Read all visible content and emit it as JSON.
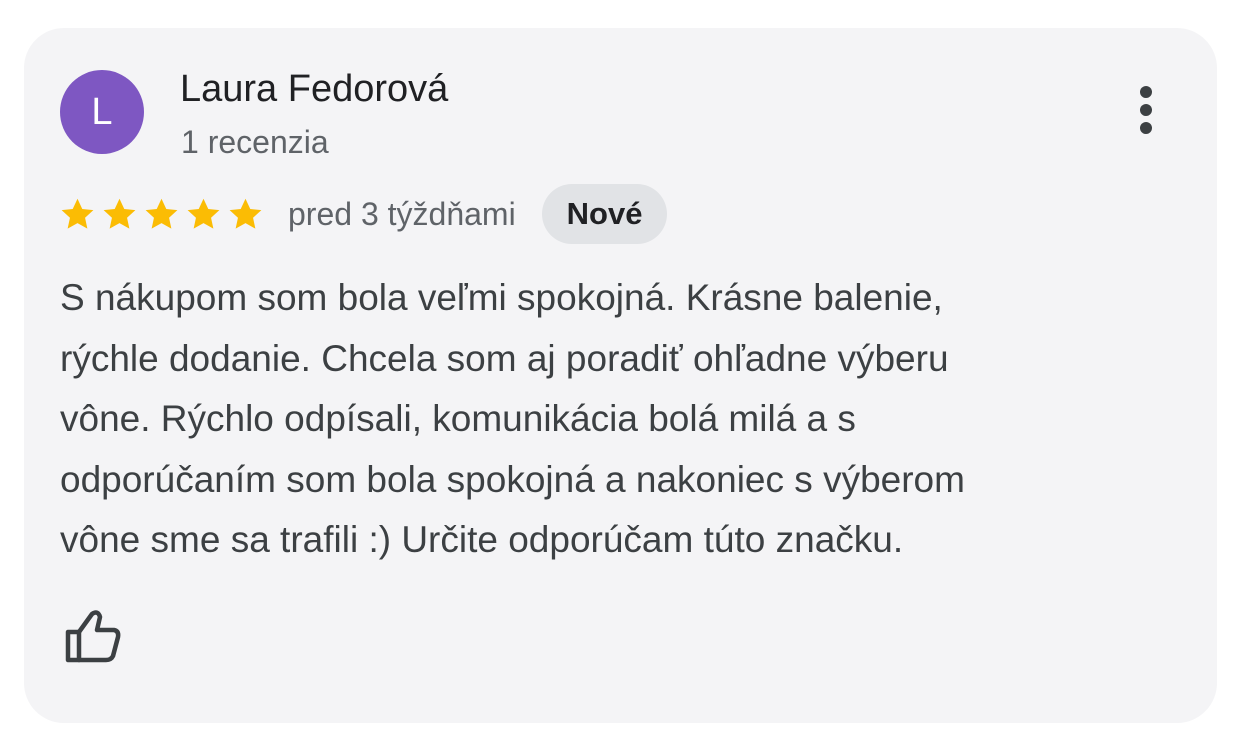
{
  "review": {
    "avatar_initial": "L",
    "author_name": "Laura Fedorová",
    "review_count": "1 recenzia",
    "rating": 5,
    "rating_max": 5,
    "date": "pred 3 týždňami",
    "badge": "Nové",
    "text_lines": [
      "S nákupom som bola veľmi spokojná. Krásne balenie,",
      "rýchle dodanie. Chcela som aj poradiť ohľadne výberu",
      "vône. Rýchlo odpísali, komunikácia bolá milá a s",
      "odporúčaním som bola spokojná a nakoniec s výberom",
      "vône sme sa trafili :) Určite odporúčam túto značku."
    ]
  },
  "icons": {
    "more": "more-vert-icon",
    "star": "star-icon",
    "like": "thumb-up-icon"
  },
  "colors": {
    "avatar": "#7e57c2",
    "star": "#fbbc04",
    "card_bg": "#f4f4f6",
    "badge_bg": "#e1e3e6"
  }
}
